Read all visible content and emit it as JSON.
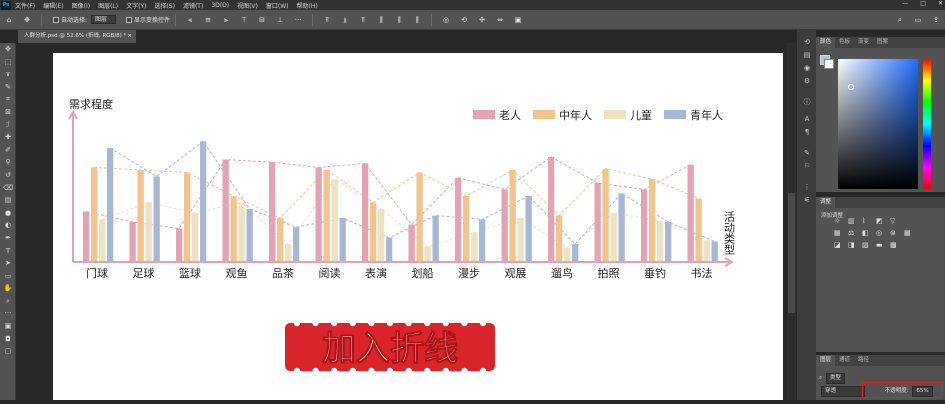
{
  "app": {
    "logo": "Ps"
  },
  "menu": [
    "文件(F)",
    "编辑(E)",
    "图像(I)",
    "图层(L)",
    "文字(Y)",
    "选择(S)",
    "滤镜(T)",
    "3D(D)",
    "视图(V)",
    "窗口(W)",
    "帮助(H)"
  ],
  "window_controls": {
    "minimize": "—",
    "maximize": "□",
    "close": "✕"
  },
  "options_bar": {
    "auto_select_label": "自动选择:",
    "auto_select_value": "图层",
    "show_transform_label": "显示变换控件"
  },
  "document_tab": {
    "title": "人群分析.psd @ 52.6% (折线, RGB/8) *",
    "close": "×"
  },
  "chart_data": {
    "type": "bar",
    "ylabel": "需求程度",
    "xlabel": "活动类型",
    "categories": [
      "门球",
      "足球",
      "篮球",
      "观鱼",
      "品茶",
      "阅读",
      "表演",
      "划船",
      "漫步",
      "观展",
      "遛鸟",
      "拍照",
      "垂钓",
      "书法"
    ],
    "series": [
      {
        "name": "老人",
        "color": "#e2a3b4",
        "values": [
          38,
          30,
          25,
          78,
          76,
          72,
          75,
          28,
          64,
          55,
          80,
          60,
          55,
          74
        ]
      },
      {
        "name": "中年人",
        "color": "#f2c48e",
        "values": [
          72,
          70,
          68,
          50,
          33,
          70,
          45,
          68,
          50,
          70,
          35,
          71,
          63,
          48
        ]
      },
      {
        "name": "儿童",
        "color": "#ede2c2",
        "values": [
          32,
          45,
          37,
          45,
          13,
          63,
          40,
          11,
          22,
          33,
          10,
          37,
          31,
          16
        ]
      },
      {
        "name": "青年人",
        "color": "#a8b7d4",
        "values": [
          87,
          65,
          92,
          40,
          26,
          33,
          18,
          35,
          32,
          50,
          13,
          52,
          30,
          15
        ]
      }
    ],
    "ylim": [
      0,
      100
    ],
    "legend_position": "top-right",
    "line_overlay": true
  },
  "banner": {
    "text": "加入折线",
    "color": "#d8242a",
    "text_color": "#fbe7b5"
  },
  "panels": {
    "color_tabs": [
      "颜色",
      "色板",
      "渐变",
      "图案"
    ],
    "adjust_tabs": [
      "调整"
    ],
    "adjust_label": "添加调整",
    "layers_tabs": [
      "图层",
      "通道",
      "路径"
    ],
    "layer_kind": "类型",
    "blend_mode": "穿透",
    "opacity_label": "不透明度:",
    "opacity_value": "65%"
  }
}
